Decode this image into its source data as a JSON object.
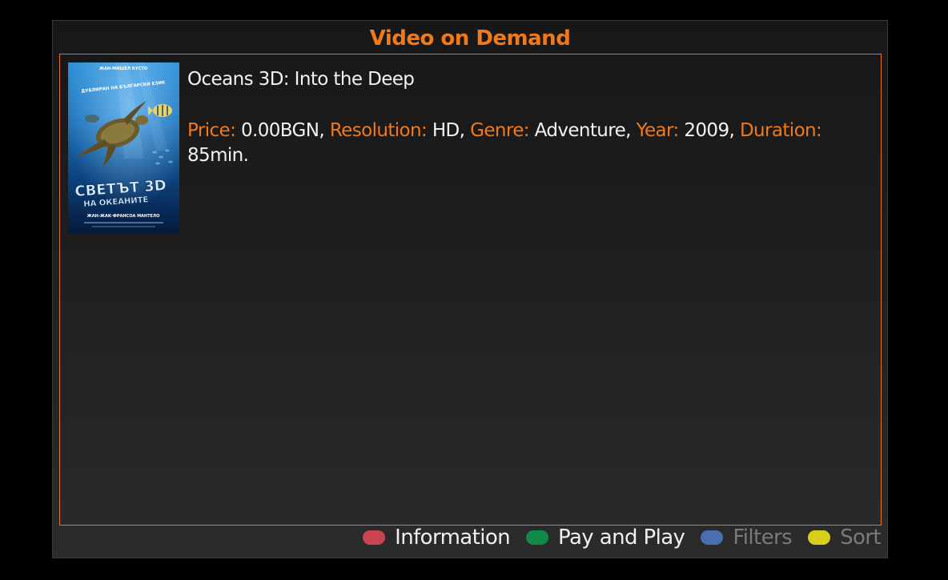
{
  "header": {
    "title": "Video on Demand"
  },
  "item": {
    "title": "Oceans 3D: Into the Deep",
    "poster": {
      "top_credit": "ЖАН-МИШЕЛ КУСТО",
      "dub_note": "ДУБЛИРАН НА БЪЛГАРСКИ ЕЗИК",
      "title_line1": "СВЕТЪТ 3D",
      "title_line2": "НА ОКЕАНИТЕ",
      "director": "ЖАН-ЖАК·ФРАНСОА МАНТЕЛО"
    },
    "meta": {
      "price_label": "Price:",
      "price_value": " 0.00BGN, ",
      "resolution_label": "Resolution:",
      "resolution_value": " HD, ",
      "genre_label": "Genre:",
      "genre_value": " Adventure, ",
      "year_label": "Year:",
      "year_value": " 2009, ",
      "duration_label": "Duration:",
      "duration_value": " 85min."
    }
  },
  "footer": {
    "hints": [
      {
        "label": "Information",
        "color": "#c8454f",
        "active": true
      },
      {
        "label": "Pay and Play",
        "color": "#0f8a4a",
        "active": true
      },
      {
        "label": "Filters",
        "color": "#4a6fb0",
        "active": false
      },
      {
        "label": "Sort",
        "color": "#d6cf1a",
        "active": false
      }
    ]
  },
  "colors": {
    "accent": "#f07a1a",
    "background": "#000000"
  }
}
